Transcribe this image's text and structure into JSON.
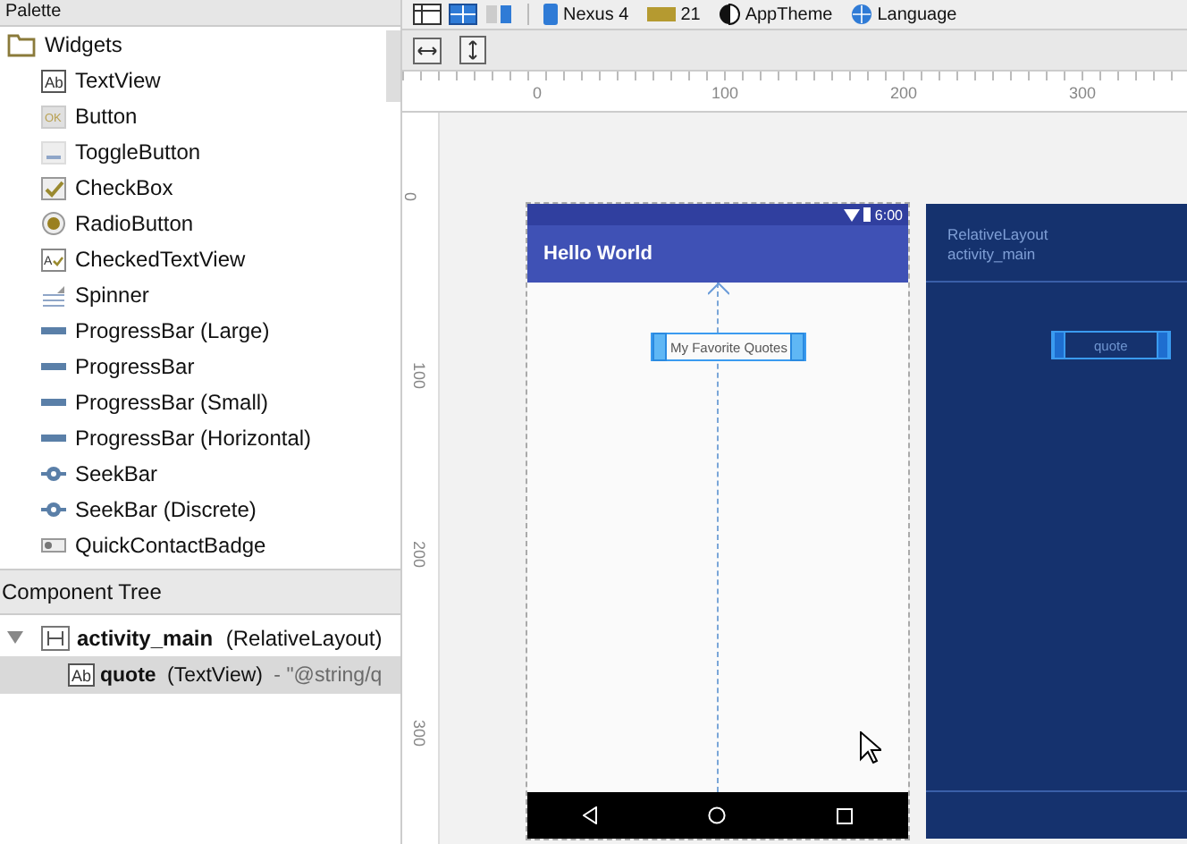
{
  "toolbar": {
    "items": [
      {
        "label": "Nexus 4",
        "kind": "device"
      },
      {
        "label": "21",
        "kind": "api"
      },
      {
        "label": "AppTheme",
        "kind": "theme"
      },
      {
        "label": "Language",
        "kind": "language"
      }
    ]
  },
  "palette": {
    "title": "Palette",
    "groups": [
      {
        "label": "Widgets",
        "children": [
          {
            "label": "TextView",
            "kind": "text",
            "icon_text": "Ab"
          },
          {
            "label": "Button",
            "kind": "button",
            "icon_text": "OK"
          },
          {
            "label": "ToggleButton",
            "kind": "toggle"
          },
          {
            "label": "CheckBox",
            "kind": "check"
          },
          {
            "label": "RadioButton",
            "kind": "radio"
          },
          {
            "label": "CheckedTextView",
            "kind": "checkedtext",
            "icon_text": "A"
          },
          {
            "label": "Spinner",
            "kind": "spinner"
          },
          {
            "label": "ProgressBar (Large)",
            "kind": "progress"
          },
          {
            "label": "ProgressBar",
            "kind": "progress"
          },
          {
            "label": "ProgressBar (Small)",
            "kind": "progress"
          },
          {
            "label": "ProgressBar (Horizontal)",
            "kind": "progress"
          },
          {
            "label": "SeekBar",
            "kind": "seek"
          },
          {
            "label": "SeekBar (Discrete)",
            "kind": "seek"
          },
          {
            "label": "QuickContactBadge",
            "kind": "badge"
          }
        ]
      }
    ]
  },
  "component_tree": {
    "title": "Component Tree",
    "nodes": [
      {
        "name": "activity_main",
        "type": "(RelativeLayout)",
        "expanded": true,
        "selected": false,
        "children": [
          {
            "name": "quote",
            "type": "(TextView)",
            "icon_text": "Ab",
            "detail": "- \"@string/q",
            "selected": true
          }
        ]
      }
    ]
  },
  "rulers": {
    "horizontal": [
      "0",
      "100",
      "200",
      "300"
    ],
    "vertical": [
      "0",
      "100",
      "200",
      "300"
    ]
  },
  "design": {
    "status_time": "6:00",
    "app_title": "Hello World",
    "text_view": "My Favorite Quotes"
  },
  "blueprint": {
    "layout_type": "RelativeLayout",
    "layout_id": "activity_main",
    "text_view": "quote"
  }
}
